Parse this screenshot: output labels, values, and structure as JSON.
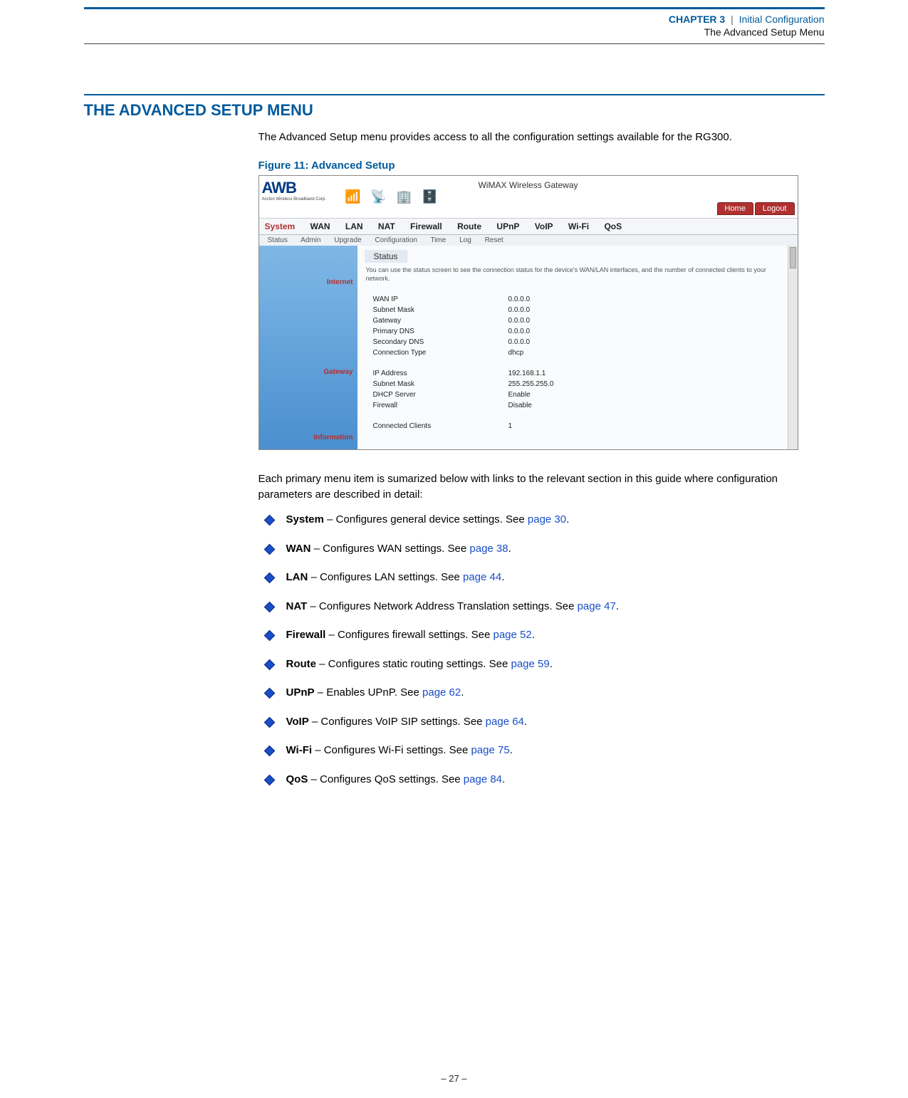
{
  "header": {
    "chapter_label": "CHAPTER 3",
    "separator": "|",
    "chapter_title": "Initial Configuration",
    "sub_title": "The Advanced Setup Menu"
  },
  "heading": "THE ADVANCED SETUP MENU",
  "intro": "The Advanced Setup menu provides access to all the configuration settings available for the RG300.",
  "figure_caption": "Figure 11:  Advanced Setup",
  "screenshot": {
    "product_title": "WiMAX Wireless Gateway",
    "logo_main": "AWB",
    "logo_sub": "Accton Wireless Broadband Corp.",
    "home_btn": "Home",
    "logout_btn": "Logout",
    "nav1": [
      "System",
      "WAN",
      "LAN",
      "NAT",
      "Firewall",
      "Route",
      "UPnP",
      "VoIP",
      "Wi-Fi",
      "QoS"
    ],
    "nav2": [
      "Status",
      "Admin",
      "Upgrade",
      "Configuration",
      "Time",
      "Log",
      "Reset"
    ],
    "status_label": "Status",
    "status_desc": "You can use the status screen to see the connection status for the device's WAN/LAN interfaces, and the number of connected clients to your network.",
    "sections": {
      "internet_label": "Internet",
      "internet_rows": [
        {
          "k": "WAN IP",
          "v": "0.0.0.0"
        },
        {
          "k": "Subnet Mask",
          "v": "0.0.0.0"
        },
        {
          "k": "Gateway",
          "v": "0.0.0.0"
        },
        {
          "k": "Primary DNS",
          "v": "0.0.0.0"
        },
        {
          "k": "Secondary DNS",
          "v": "0.0.0.0"
        },
        {
          "k": "Connection Type",
          "v": "dhcp"
        }
      ],
      "gateway_label": "Gateway",
      "gateway_rows": [
        {
          "k": "IP Address",
          "v": "192.168.1.1"
        },
        {
          "k": "Subnet Mask",
          "v": "255.255.255.0"
        },
        {
          "k": "DHCP Server",
          "v": "Enable"
        },
        {
          "k": "Firewall",
          "v": "Disable"
        }
      ],
      "info_label": "Information",
      "info_rows": [
        {
          "k": "Connected Clients",
          "v": "1"
        }
      ]
    }
  },
  "para2": "Each primary menu item is sumarized below with links to the relevant section in this guide where configuration parameters are described in detail:",
  "bullets": [
    {
      "bold": "System",
      "desc": " – Configures general device settings. See ",
      "link": "page 30",
      "tail": "."
    },
    {
      "bold": "WAN",
      "desc": " – Configures WAN settings. See ",
      "link": "page 38",
      "tail": "."
    },
    {
      "bold": "LAN",
      "desc": " – Configures LAN settings. See ",
      "link": "page 44",
      "tail": "."
    },
    {
      "bold": "NAT",
      "desc": " – Configures Network Address Translation settings. See ",
      "link": "page 47",
      "tail": "."
    },
    {
      "bold": "Firewall",
      "desc": " – Configures firewall settings. See ",
      "link": "page 52",
      "tail": "."
    },
    {
      "bold": "Route",
      "desc": " – Configures static routing settings. See ",
      "link": "page 59",
      "tail": "."
    },
    {
      "bold": "UPnP",
      "desc": " – Enables UPnP. See ",
      "link": "page 62",
      "tail": "."
    },
    {
      "bold": "VoIP",
      "desc": " – Configures VoIP SIP settings. See ",
      "link": "page 64",
      "tail": "."
    },
    {
      "bold": "Wi-Fi",
      "desc": " – Configures Wi-Fi settings. See ",
      "link": "page 75",
      "tail": "."
    },
    {
      "bold": "QoS",
      "desc": " – Configures QoS settings. See ",
      "link": "page 84",
      "tail": "."
    }
  ],
  "footer": "–  27  –"
}
